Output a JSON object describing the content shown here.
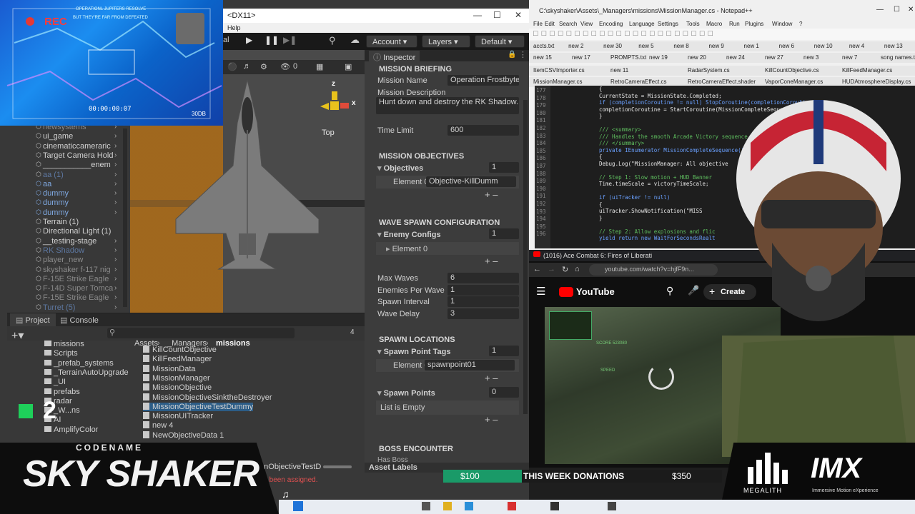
{
  "hud": {
    "rec": "REC",
    "line1": "OPERATIONL JUPITERS RESOLVE",
    "line2": "BUT THEY'RE FAR FROM DEFEATED",
    "timecode": "00:00:00:07",
    "db": "30DB"
  },
  "unity": {
    "title": "<DX11>",
    "menu_help": "Help",
    "toolbar": {
      "account": "Account",
      "layers": "Layers",
      "layout": "Default"
    },
    "scene": {
      "orientation": "Top",
      "axis_x": "x",
      "axis_z": "z",
      "gizmo_count": "0",
      "tab_partial": "al"
    },
    "hierarchy": [
      {
        "label": "newsystems",
        "style": "grey",
        "arrow": true
      },
      {
        "label": "ui_game",
        "style": "",
        "arrow": true
      },
      {
        "label": "cinematiccameraric",
        "style": "",
        "arrow": true
      },
      {
        "label": "Target Camera Hold",
        "style": "",
        "arrow": true
      },
      {
        "label": "___________enem",
        "style": "",
        "arrow": true
      },
      {
        "label": "aa (1)",
        "style": "faded",
        "arrow": true
      },
      {
        "label": "aa",
        "style": "blue",
        "arrow": true
      },
      {
        "label": "dummy",
        "style": "blue",
        "arrow": true
      },
      {
        "label": "dummy",
        "style": "blue",
        "arrow": true
      },
      {
        "label": "dummy",
        "style": "blue",
        "arrow": true
      },
      {
        "label": "Terrain (1)",
        "style": "",
        "arrow": false
      },
      {
        "label": "Directional Light (1)",
        "style": "",
        "arrow": false
      },
      {
        "label": "__testing-stage",
        "style": "",
        "arrow": true
      },
      {
        "label": "RK Shadow",
        "style": "faded",
        "arrow": true
      },
      {
        "label": "player_new",
        "style": "grey",
        "arrow": true
      },
      {
        "label": "skyshaker f-117 nig",
        "style": "grey",
        "arrow": true
      },
      {
        "label": "F-15E Strike Eagle",
        "style": "grey",
        "arrow": true
      },
      {
        "label": "F-14D Super Tomca",
        "style": "grey",
        "arrow": true
      },
      {
        "label": "F-15E Strike Eagle",
        "style": "grey",
        "arrow": true
      },
      {
        "label": "Turret (5)",
        "style": "faded",
        "arrow": true
      }
    ],
    "project": {
      "tab_project": "Project",
      "tab_console": "Console",
      "folders": [
        "missions",
        "Scripts",
        "_prefab_systems",
        "_TerrainAutoUpgrade",
        "_UI",
        "prefabs",
        "radar",
        "_W...ns",
        "AI",
        "AmplifyColor"
      ],
      "breadcrumb": [
        "Assets",
        "_Managers",
        "missions"
      ],
      "files": [
        "KillCountObjective",
        "KillFeedManager",
        "MissionData",
        "MissionManager",
        "MissionObjective",
        "MissionObjectiveSinktheDestroyer",
        "MissionObjectiveTestDummy",
        "MissionUITracker",
        "new 4",
        "NewObjectiveData 1"
      ],
      "file_partial": "hrones",
      "status_file": "MissionObjectiveTestD",
      "error": "not been assigned.",
      "count": "4"
    },
    "inspector": {
      "tab": "Inspector",
      "briefing_header": "MISSION BRIEFING",
      "mission_name_label": "Mission Name",
      "mission_name": "Operation Frostbyte",
      "mission_desc_label": "Mission Description",
      "mission_desc": "Hunt down and destroy the RK Shadow.",
      "time_limit_label": "Time Limit",
      "time_limit": "600",
      "objectives_header": "MISSION OBJECTIVES",
      "objectives_label": "Objectives",
      "objectives_count": "1",
      "objective_element": "Element 0",
      "objective_value": "Objective-KillDumm",
      "wave_header": "WAVE SPAWN CONFIGURATION",
      "enemy_configs_label": "Enemy Configs",
      "enemy_configs_count": "1",
      "enemy_element": "Element 0",
      "max_waves_label": "Max Waves",
      "max_waves": "6",
      "enemies_per_wave_label": "Enemies Per Wave",
      "enemies_per_wave": "1",
      "spawn_interval_label": "Spawn Interval",
      "spawn_interval": "1",
      "wave_delay_label": "Wave Delay",
      "wave_delay": "3",
      "spawn_loc_header": "SPAWN LOCATIONS",
      "spawn_tags_label": "Spawn Point Tags",
      "spawn_tags_count": "1",
      "spawn_tag_element": "Element 0",
      "spawn_tag_value": "spawnpoint01",
      "spawn_points_label": "Spawn Points",
      "spawn_points_count": "0",
      "list_empty": "List is Empty",
      "boss_header": "BOSS ENCOUNTER",
      "has_boss_label": "Has Boss",
      "asset_labels": "Asset Labels"
    }
  },
  "npp": {
    "title": "C:\\skyshaker\\Assets\\_Managers\\missions\\MissionManager.cs - Notepad++",
    "menu": [
      "File",
      "Edit",
      "Search",
      "View",
      "Encoding",
      "Language",
      "Settings",
      "Tools",
      "Macro",
      "Run",
      "Plugins",
      "Window",
      "?"
    ],
    "tabs_row1": [
      "accts.txt",
      "new 2",
      "new 30",
      "new 5",
      "new 8",
      "new 9",
      "new 1",
      "new 6",
      "new 10",
      "new 4",
      "new 13"
    ],
    "tabs_row2": [
      "new 15",
      "new 17",
      "PROMPTS.txt",
      "new 19",
      "new 20",
      "new 24",
      "new 27",
      "new 3",
      "new 7",
      "song names.txt"
    ],
    "tabs_row3": [
      "ItemCSVImporter.cs",
      "new 11",
      "RadarSystem.cs",
      "KillCountObjective.cs",
      "KillFeedManager.cs"
    ],
    "tabs_row4": [
      "MissionManager.cs",
      "RetroCameraEffect.cs",
      "RetroCameraEffect.shader",
      "VaporConeManager.cs",
      "HUDAtmosphereDisplay.cs"
    ],
    "line_numbers": [
      "177",
      "178",
      "179",
      "180",
      "181",
      "182",
      "183",
      "184",
      "185",
      "186",
      "187",
      "188",
      "189",
      "190",
      "191",
      "192",
      "193",
      "194",
      "195",
      "196"
    ],
    "code": [
      "{",
      "    CurrentState = MissionState.Completed;",
      "    if (completionCoroutine != null) StopCoroutine(completionCoroutine);",
      "    completionCoroutine = StartCoroutine(MissionCompleteSequence());",
      "}",
      "",
      "/// <summary>",
      "/// Handles the smooth Arcade Victory sequence",
      "/// </summary>",
      "private IEnumerator MissionCompleteSequence()",
      "{",
      "    Debug.Log(\"MissionManager: All objective",
      "",
      "    // Step 1: Slow motion + HUD Banner",
      "    Time.timeScale = victoryTimeScale;",
      "",
      "    if (uiTracker != null)",
      "    {",
      "        uiTracker.ShowNotification(\"MISS",
      "    }",
      "",
      "    // Step 2: Allow explosions and flic",
      "    yield return new WaitForSecondsRealt"
    ]
  },
  "youtube": {
    "tab_title": "(1016) Ace Combat 6: Fires of Liberati",
    "url": "youtube.com/watch?v=hjfF9n...",
    "brand": "YouTube",
    "create": "Create",
    "hud_score": "SCORE 523080",
    "hud_speed": "SPEED"
  },
  "overlay": {
    "codename": "CODENAME",
    "title": "SKY SHAKER",
    "counter": "2",
    "don_left": "$100",
    "don_label": "THIS WEEK DONATIONS",
    "don_right": "$350",
    "megalith": "MEGALITH",
    "imx": "IMX",
    "imx_sub": "Immersive Motion eXperience"
  }
}
